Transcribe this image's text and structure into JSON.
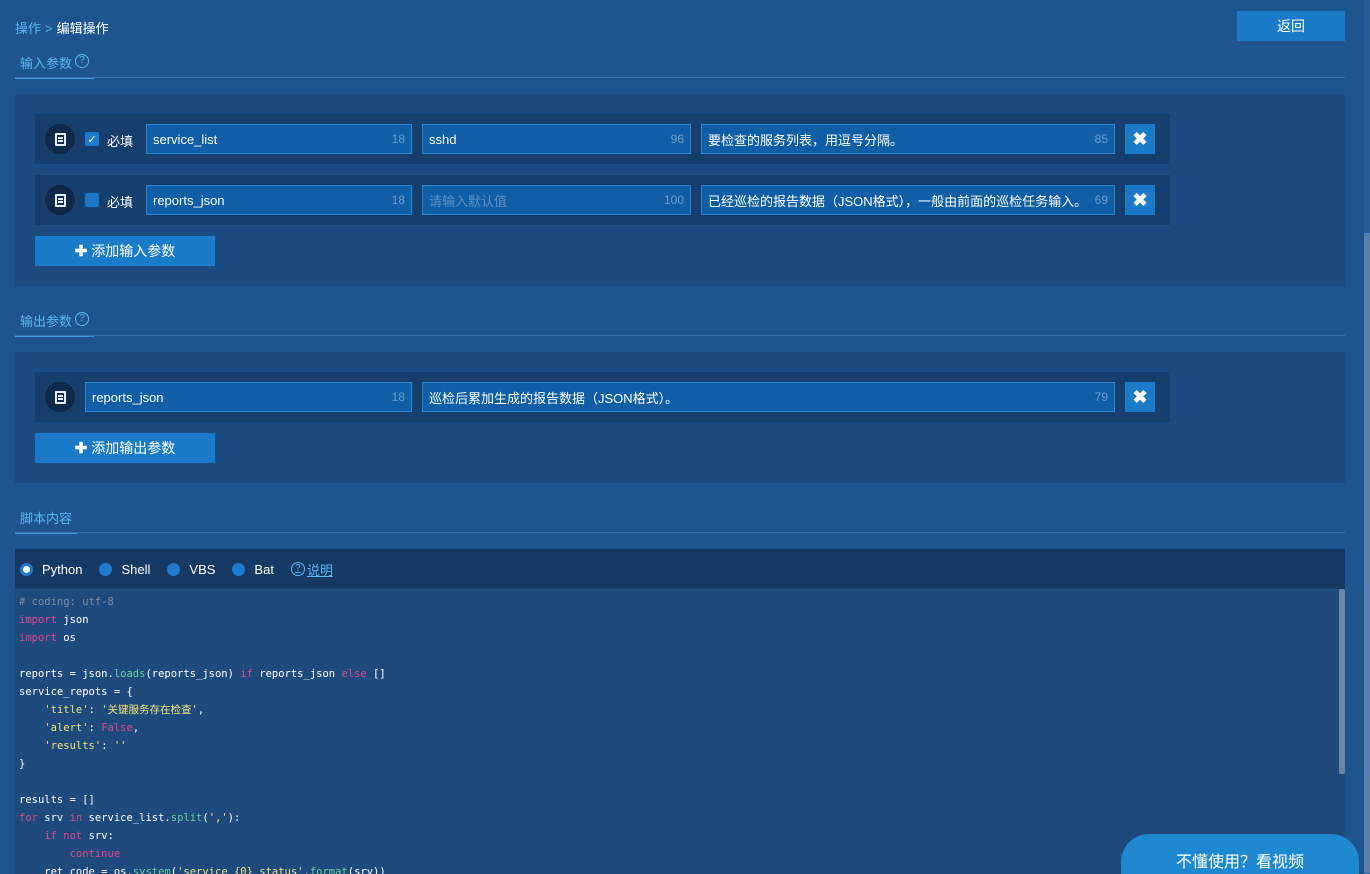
{
  "breadcrumb": {
    "parent": "操作",
    "separator": ">",
    "current": "编辑操作"
  },
  "back_button": "返回",
  "input_section": {
    "title": "输入参数",
    "help_icon": "?",
    "rows": [
      {
        "required_label": "必填",
        "required": true,
        "name": "service_list",
        "name_count": "18",
        "default": "sshd",
        "default_placeholder": "",
        "default_count": "96",
        "description": "要检查的服务列表，用逗号分隔。",
        "description_count": "85"
      },
      {
        "required_label": "必填",
        "required": false,
        "name": "reports_json",
        "name_count": "18",
        "default": "",
        "default_placeholder": "请输入默认值",
        "default_count": "100",
        "description": "已经巡检的报告数据（JSON格式），一般由前面的巡检任务输入。",
        "description_count": "69"
      }
    ],
    "add_label": "添加输入参数"
  },
  "output_section": {
    "title": "输出参数",
    "help_icon": "?",
    "rows": [
      {
        "name": "reports_json",
        "name_count": "18",
        "description": "巡检后累加生成的报告数据（JSON格式）。",
        "description_count": "79"
      }
    ],
    "add_label": "添加输出参数"
  },
  "script_section": {
    "title": "脚本内容",
    "languages": [
      {
        "label": "Python",
        "selected": true
      },
      {
        "label": "Shell",
        "selected": false
      },
      {
        "label": "VBS",
        "selected": false
      },
      {
        "label": "Bat",
        "selected": false
      }
    ],
    "help_icon": "?",
    "help_label": "说明",
    "code_lines": [
      "# coding: utf-8",
      "import json",
      "import os",
      "",
      "reports = json.loads(reports_json) if reports_json else []",
      "service_repots = {",
      "    'title': '关键服务存在检查',",
      "    'alert': False,",
      "    'results': ''",
      "}",
      "",
      "results = []",
      "for srv in service_list.split(','):",
      "    if not srv:",
      "        continue",
      "    ret_code = os.system('service {0} status'.format(srv))"
    ]
  },
  "help_video": "不懂使用？看视频",
  "colors": {
    "background": "#1e5590",
    "accent": "#1a7cc8",
    "link": "#5bb5f0"
  }
}
